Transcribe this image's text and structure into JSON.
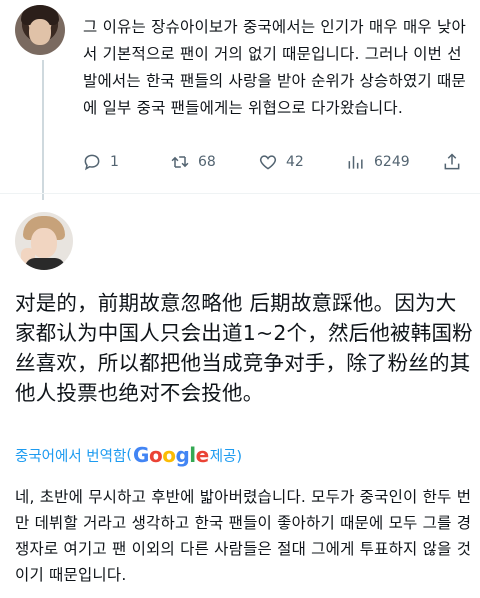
{
  "first_reply": {
    "text": "그 이유는 장슈아이보가 중국에서는 인기가 매우 매우 낮아서 기본적으로 팬이 거의 없기 때문입니다. 그러나 이번 선발에서는 한국 팬들의 사랑을 받아 순위가 상승하였기 때문에 일부 중국 팬들에게는 위협으로 다가왔습니다.",
    "actions": {
      "reply_count": "1",
      "retweet_count": "68",
      "like_count": "42",
      "view_count": "6249"
    }
  },
  "second_post": {
    "text": "对是的，前期故意忽略他 后期故意踩他。因为大家都认为中国人只会出道1~2个，然后他被韩国粉丝喜欢，所以都把他当成竞争对手，除了粉丝的其他人投票也绝对不会投他。",
    "translate_prefix": "중국어에서 번역함",
    "translate_open": "(",
    "translate_brand": "Google",
    "translate_suffix": " 제공)",
    "translated_text": "네, 초반에 무시하고 후반에 밟아버렸습니다. 모두가 중국인이 한두 번만 데뷔할 거라고 생각하고 한국 팬들이 좋아하기 때문에 모두 그를 경쟁자로 여기고 팬 이외의 다른 사람들은 절대 그에게 투표하지 않을 것이기 때문입니다."
  },
  "icons": [
    "reply-icon",
    "retweet-icon",
    "like-icon",
    "views-icon",
    "share-icon"
  ],
  "colors": {
    "text": "#0f1419",
    "muted": "#536471",
    "link": "#1d9bf0"
  }
}
